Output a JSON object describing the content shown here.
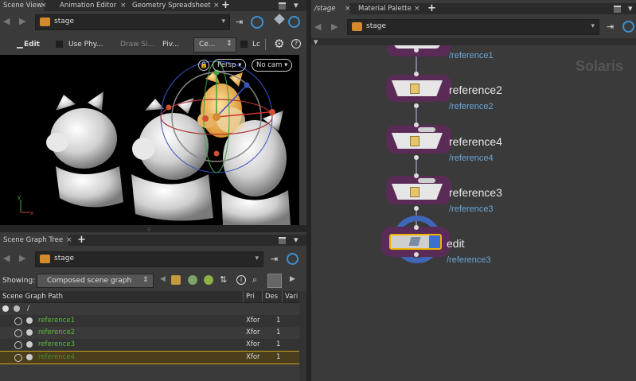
{
  "left_tabs": [
    {
      "label": "Scene View",
      "active": true
    },
    {
      "label": "Animation Editor",
      "active": false
    },
    {
      "label": "Geometry Spreadsheet",
      "active": false
    }
  ],
  "left_path": "stage",
  "viewport_toolbar": {
    "edit": "Edit",
    "use_physics": "Use Phy...",
    "draw_style": "Draw Si...",
    "pivot": "Piv...",
    "center": "Ce...",
    "lc": "Lc"
  },
  "viewport_hud": {
    "persp": "Persp ▾",
    "nocam": "No cam ▾"
  },
  "scene_graph_tab": "Scene Graph Tree",
  "sg_path": "stage",
  "showing_label": "Showing:",
  "showing_value": "Composed scene graph",
  "sg_columns": {
    "path": "Scene Graph Path",
    "pri": "Pri",
    "des": "Des",
    "vari": "Vari"
  },
  "sg_root": "/",
  "sg_rows": [
    {
      "name": "reference1",
      "pri": "Xfor",
      "des": "1"
    },
    {
      "name": "reference2",
      "pri": "Xfor",
      "des": "1"
    },
    {
      "name": "reference3",
      "pri": "Xfor",
      "des": "1"
    },
    {
      "name": "reference4",
      "pri": "Xfor",
      "des": "1"
    }
  ],
  "right_tabs": [
    {
      "label": "/stage",
      "active": true
    },
    {
      "label": "Material Palette",
      "active": false
    }
  ],
  "right_path": "stage",
  "network_context": "Solaris",
  "nodes": [
    {
      "label": "",
      "path": "/reference1"
    },
    {
      "label": "reference2",
      "path": "/reference2"
    },
    {
      "label": "reference4",
      "path": "/reference4"
    },
    {
      "label": "reference3",
      "path": "/reference3"
    },
    {
      "label": "edit",
      "path": "/reference3"
    }
  ],
  "colors": {
    "accent": "#f0b400",
    "node_bg": "#5a2b56",
    "selected": "#f0b400",
    "path_text": "#6aa6d6",
    "sg_text": "#5dbb3a"
  }
}
